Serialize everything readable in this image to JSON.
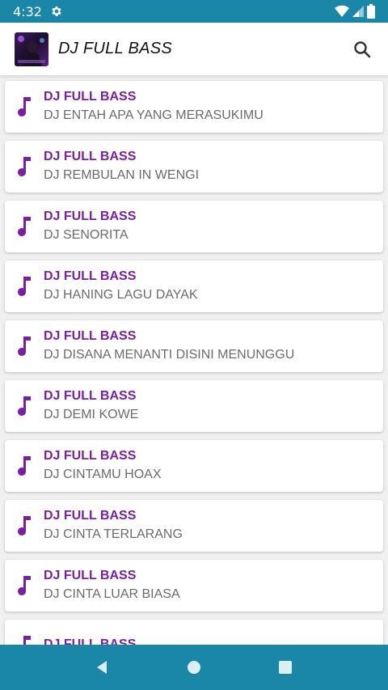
{
  "status_bar": {
    "time": "4:32"
  },
  "app_bar": {
    "title": "DJ FULL BASS"
  },
  "list": [
    {
      "title": "DJ FULL BASS",
      "subtitle": "DJ ENTAH APA YANG MERASUKIMU"
    },
    {
      "title": "DJ FULL BASS",
      "subtitle": "DJ REMBULAN IN WENGI"
    },
    {
      "title": "DJ FULL BASS",
      "subtitle": "DJ SENORITA"
    },
    {
      "title": "DJ FULL BASS",
      "subtitle": "DJ HANING LAGU DAYAK"
    },
    {
      "title": "DJ FULL BASS",
      "subtitle": "DJ DISANA MENANTI DISINI MENUNGGU"
    },
    {
      "title": "DJ FULL BASS",
      "subtitle": "DJ DEMI KOWE"
    },
    {
      "title": "DJ FULL BASS",
      "subtitle": "DJ CINTAMU HOAX"
    },
    {
      "title": "DJ FULL BASS",
      "subtitle": "DJ CINTA TERLARANG"
    },
    {
      "title": "DJ FULL BASS",
      "subtitle": "DJ CINTA LUAR BIASA"
    },
    {
      "title": "DJ FULL BASS",
      "subtitle": ""
    }
  ],
  "colors": {
    "status_bar": "#1a86a8",
    "accent": "#7b1fa2",
    "subtitle": "#6b6b6b",
    "nav_bar": "#1a86a8"
  },
  "icons": {
    "status_settings": "gear-icon",
    "wifi": "wifi-icon",
    "signal": "signal-icon",
    "battery": "battery-icon",
    "search": "search-icon",
    "item": "music-note-icon",
    "nav_back": "back-icon",
    "nav_home": "home-icon",
    "nav_recents": "recents-icon"
  }
}
